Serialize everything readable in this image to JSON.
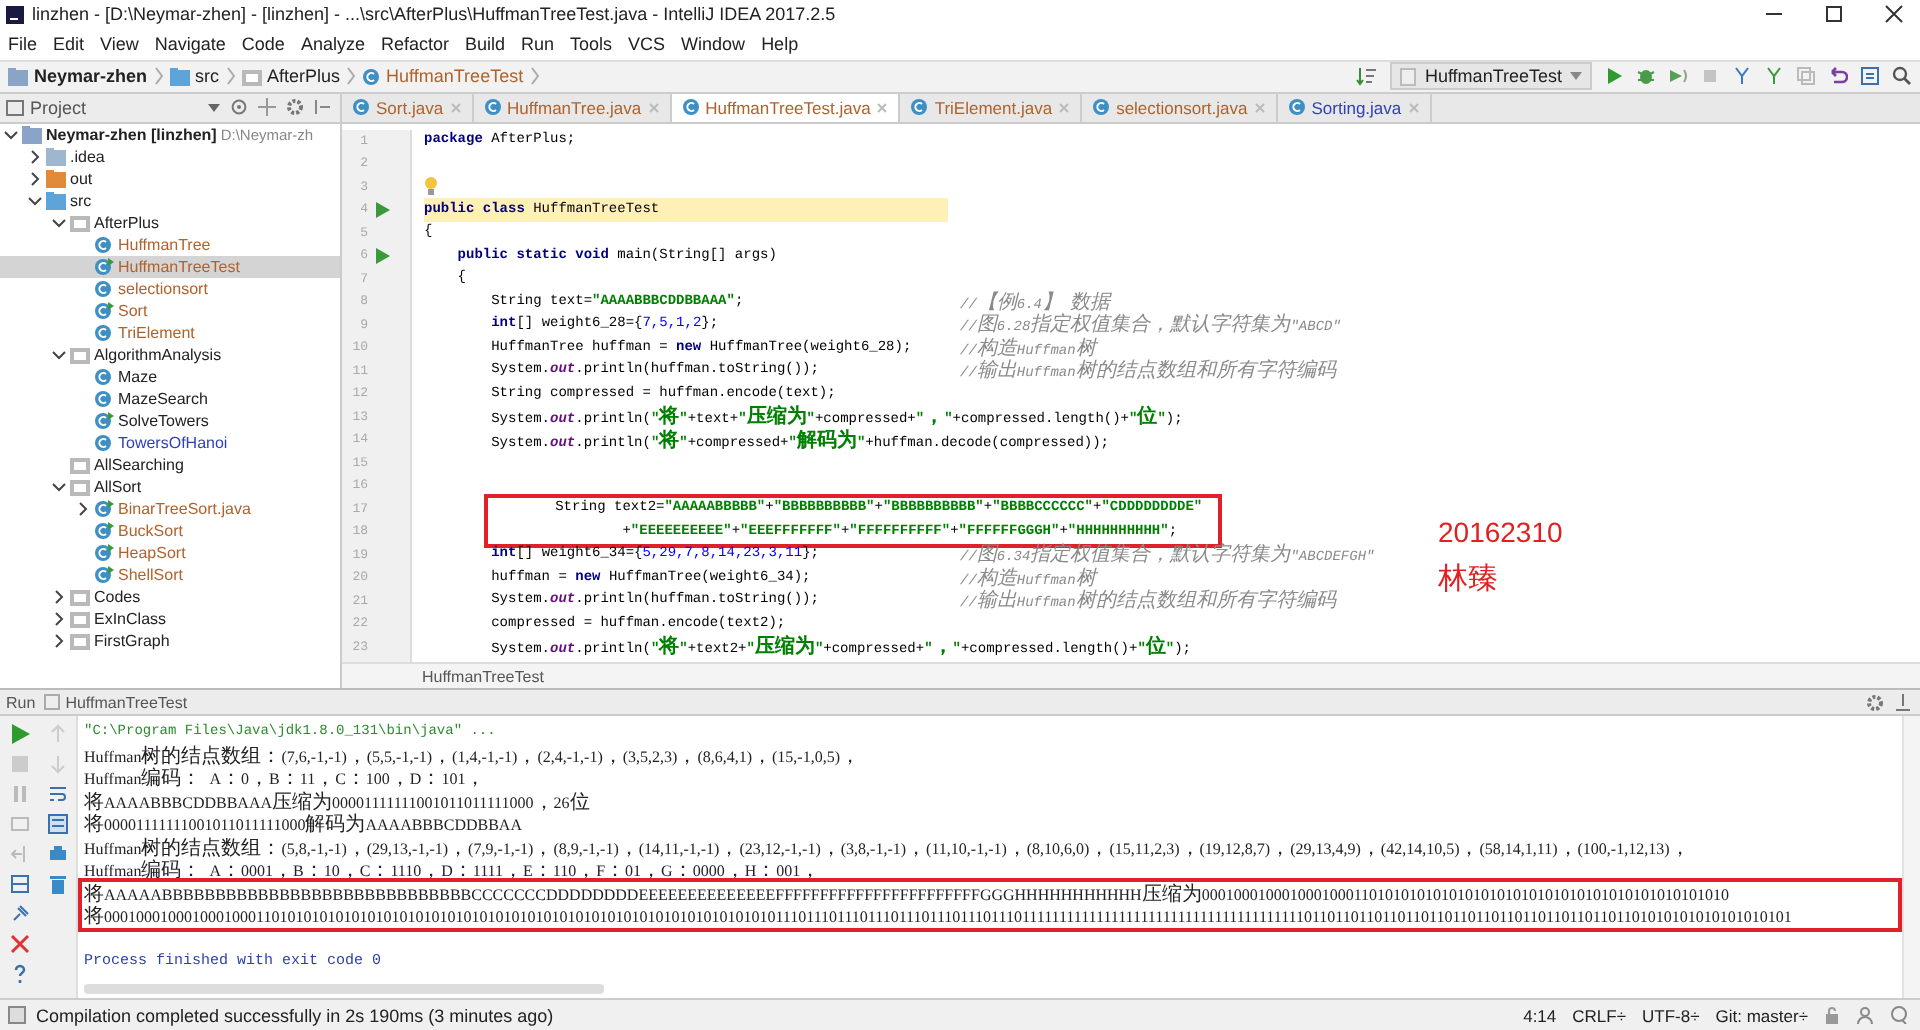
{
  "window": {
    "title": "linzhen - [D:\\Neymar-zhen] - [linzhen] - ...\\src\\AfterPlus\\HuffmanTreeTest.java - IntelliJ IDEA 2017.2.5"
  },
  "menu": [
    "File",
    "Edit",
    "View",
    "Navigate",
    "Code",
    "Analyze",
    "Refactor",
    "Build",
    "Run",
    "Tools",
    "VCS",
    "Window",
    "Help"
  ],
  "breadcrumb": [
    {
      "label": "Neymar-zhen",
      "kind": "module"
    },
    {
      "label": "src",
      "kind": "source"
    },
    {
      "label": "AfterPlus",
      "kind": "package"
    },
    {
      "label": "HuffmanTreeTest",
      "kind": "main"
    }
  ],
  "run_config": "HuffmanTreeTest",
  "project": {
    "title": "Project",
    "tree": [
      {
        "label": "Neymar-zhen [linzhen]",
        "path": "D:\\Neymar-zh",
        "kind": "module",
        "expanded": true,
        "selected": false,
        "children": [
          {
            "label": ".idea",
            "kind": "folder",
            "expanded": false,
            "selected": false
          },
          {
            "label": "out",
            "kind": "excluded",
            "expanded": false,
            "selected": false
          },
          {
            "label": "src",
            "kind": "source",
            "expanded": true,
            "selected": false,
            "children": [
              {
                "label": "AfterPlus",
                "kind": "package",
                "expanded": true,
                "selected": false,
                "children": [
                  {
                    "label": "HuffmanTree",
                    "kind": "class",
                    "color": "#b0622c",
                    "selected": false
                  },
                  {
                    "label": "HuffmanTreeTest",
                    "kind": "main",
                    "color": "#b0622c",
                    "selected": true
                  },
                  {
                    "label": "selectionsort",
                    "kind": "class",
                    "color": "#b0622c",
                    "selected": false
                  },
                  {
                    "label": "Sort",
                    "kind": "main",
                    "color": "#b0622c",
                    "selected": false
                  },
                  {
                    "label": "TriElement",
                    "kind": "class",
                    "color": "#b0622c",
                    "selected": false
                  }
                ]
              },
              {
                "label": "AlgorithmAnalysis",
                "kind": "package",
                "expanded": true,
                "selected": false,
                "children": [
                  {
                    "label": "Maze",
                    "kind": "class",
                    "color": "#222222",
                    "selected": false
                  },
                  {
                    "label": "MazeSearch",
                    "kind": "class",
                    "color": "#222222",
                    "selected": false
                  },
                  {
                    "label": "SolveTowers",
                    "kind": "main",
                    "color": "#222222",
                    "selected": false
                  },
                  {
                    "label": "TowersOfHanoi",
                    "kind": "class",
                    "color": "#3040b8",
                    "selected": false
                  }
                ]
              },
              {
                "label": "AllSearching",
                "kind": "package",
                "selected": false
              },
              {
                "label": "AllSort",
                "kind": "package",
                "expanded": true,
                "selected": false,
                "children": [
                  {
                    "label": "BinarTreeSort.java",
                    "kind": "main",
                    "color": "#b0622c",
                    "expanded": false,
                    "selected": false
                  },
                  {
                    "label": "BuckSort",
                    "kind": "main",
                    "color": "#b0622c",
                    "selected": false
                  },
                  {
                    "label": "HeapSort",
                    "kind": "main",
                    "color": "#b0622c",
                    "selected": false
                  },
                  {
                    "label": "ShellSort",
                    "kind": "main",
                    "color": "#b0622c",
                    "selected": false
                  }
                ]
              },
              {
                "label": "Codes",
                "kind": "package",
                "expanded": false,
                "selected": false
              },
              {
                "label": "ExInClass",
                "kind": "package",
                "expanded": false,
                "selected": false
              },
              {
                "label": "FirstGraph",
                "kind": "package",
                "expanded": false,
                "selected": false
              }
            ]
          }
        ]
      }
    ]
  },
  "tabs": [
    {
      "label": "Sort.java",
      "color": "#b0622c",
      "selected": false
    },
    {
      "label": "HuffmanTree.java",
      "color": "#b0622c",
      "selected": false
    },
    {
      "label": "HuffmanTreeTest.java",
      "color": "#b0622c",
      "selected": true
    },
    {
      "label": "TriElement.java",
      "color": "#b0622c",
      "selected": false
    },
    {
      "label": "selectionsort.java",
      "color": "#b0622c",
      "selected": false
    },
    {
      "label": "Sorting.java",
      "color": "#3040b8",
      "selected": false
    }
  ],
  "editor": {
    "lines": [
      {
        "number": "1",
        "kind": "code",
        "current": false,
        "boxed": false,
        "code": [
          {
            "kind": "kw",
            "text": "package"
          },
          {
            "kind": "pl",
            "text": " AfterPlus;"
          }
        ]
      },
      {
        "number": "2",
        "kind": "code"
      },
      {
        "number": "3",
        "kind": "bulb"
      },
      {
        "number": "4",
        "kind": "run",
        "current": true,
        "boxed": false,
        "code": [
          {
            "kind": "kw",
            "text": "public class "
          },
          {
            "kind": "pl",
            "text": "HuffmanTreeTest"
          }
        ]
      },
      {
        "number": "5",
        "kind": "code",
        "current": false,
        "boxed": false,
        "code": [
          {
            "kind": "pl",
            "text": "{"
          }
        ]
      },
      {
        "number": "6",
        "kind": "run",
        "current": false,
        "boxed": false,
        "code": [
          {
            "kind": "kw",
            "text": "    public static void "
          },
          {
            "kind": "pl",
            "text": "main(String[] args)"
          }
        ]
      },
      {
        "number": "7",
        "kind": "code",
        "current": false,
        "boxed": false,
        "code": [
          {
            "kind": "pl",
            "text": "    {"
          }
        ]
      },
      {
        "number": "8",
        "kind": "code",
        "current": false,
        "boxed": false,
        "code": [
          {
            "kind": "pl",
            "text": "        String text="
          },
          {
            "kind": "str",
            "text": "\"AAAABBBCDDBBAAA\""
          },
          {
            "kind": "pl",
            "text": ";"
          }
        ],
        "comment": "//【例6.4】 数据"
      },
      {
        "number": "9",
        "kind": "code",
        "current": false,
        "boxed": false,
        "code": [
          {
            "kind": "kw",
            "text": "        int"
          },
          {
            "kind": "pl",
            "text": "[] weight6_28={"
          },
          {
            "kind": "num",
            "text": "7,5,1,2"
          },
          {
            "kind": "pl",
            "text": "};"
          }
        ],
        "comment": "//图6.28指定权值集合，默认字符集为\"ABCD\""
      },
      {
        "number": "10",
        "kind": "code",
        "current": false,
        "boxed": false,
        "code": [
          {
            "kind": "pl",
            "text": "        HuffmanTree huffman = "
          },
          {
            "kind": "kw",
            "text": "new "
          },
          {
            "kind": "pl",
            "text": "HuffmanTree(weight6_28);"
          }
        ],
        "comment": "//构造Huffman树"
      },
      {
        "number": "11",
        "kind": "code",
        "current": false,
        "boxed": false,
        "code": [
          {
            "kind": "pl",
            "text": "        System."
          },
          {
            "kind": "fld",
            "text": "out"
          },
          {
            "kind": "pl",
            "text": ".println(huffman.toString());"
          }
        ],
        "comment": "//输出Huffman树的结点数组和所有字符编码"
      },
      {
        "number": "12",
        "kind": "code",
        "current": false,
        "boxed": false,
        "code": [
          {
            "kind": "pl",
            "text": "        String compressed = huffman.encode(text);"
          }
        ]
      },
      {
        "number": "13",
        "kind": "code",
        "current": false,
        "boxed": false,
        "code": [
          {
            "kind": "pl",
            "text": "        System."
          },
          {
            "kind": "fld",
            "text": "out"
          },
          {
            "kind": "pl",
            "text": ".println("
          },
          {
            "kind": "str",
            "text": "\"将\""
          },
          {
            "kind": "pl",
            "text": "+text+"
          },
          {
            "kind": "str",
            "text": "\"压缩为\""
          },
          {
            "kind": "pl",
            "text": "+compressed+"
          },
          {
            "kind": "str",
            "text": "\"，\""
          },
          {
            "kind": "pl",
            "text": "+compressed.length()+"
          },
          {
            "kind": "str",
            "text": "\"位\""
          },
          {
            "kind": "pl",
            "text": ");"
          }
        ]
      },
      {
        "number": "14",
        "kind": "code",
        "current": false,
        "boxed": false,
        "code": [
          {
            "kind": "pl",
            "text": "        System."
          },
          {
            "kind": "fld",
            "text": "out"
          },
          {
            "kind": "pl",
            "text": ".println("
          },
          {
            "kind": "str",
            "text": "\"将\""
          },
          {
            "kind": "pl",
            "text": "+compressed+"
          },
          {
            "kind": "str",
            "text": "\"解码为\""
          },
          {
            "kind": "pl",
            "text": "+huffman.decode(compressed));"
          }
        ]
      },
      {
        "number": "15",
        "kind": "code"
      },
      {
        "number": "16",
        "kind": "code"
      },
      {
        "number": "17",
        "kind": "code",
        "current": false,
        "boxed": true,
        "code": [
          {
            "kind": "pl",
            "text": "        String text2="
          },
          {
            "kind": "str",
            "text": "\"AAAAABBBBB\""
          },
          {
            "kind": "pl",
            "text": "+"
          },
          {
            "kind": "str",
            "text": "\"BBBBBBBBBB\""
          },
          {
            "kind": "pl",
            "text": "+"
          },
          {
            "kind": "str",
            "text": "\"BBBBBBBBBB\""
          },
          {
            "kind": "pl",
            "text": "+"
          },
          {
            "kind": "str",
            "text": "\"BBBBCCCCCC\""
          },
          {
            "kind": "pl",
            "text": "+"
          },
          {
            "kind": "str",
            "text": "\"CDDDDDDDDE\""
          }
        ]
      },
      {
        "number": "18",
        "kind": "code",
        "current": false,
        "boxed": true,
        "code": [
          {
            "kind": "pl",
            "text": "                +"
          },
          {
            "kind": "str",
            "text": "\"EEEEEEEEEE\""
          },
          {
            "kind": "pl",
            "text": "+"
          },
          {
            "kind": "str",
            "text": "\"EEEFFFFFFF\""
          },
          {
            "kind": "pl",
            "text": "+"
          },
          {
            "kind": "str",
            "text": "\"FFFFFFFFFF\""
          },
          {
            "kind": "pl",
            "text": "+"
          },
          {
            "kind": "str",
            "text": "\"FFFFFFGGGH\""
          },
          {
            "kind": "pl",
            "text": "+"
          },
          {
            "kind": "str",
            "text": "\"HHHHHHHHHH\""
          },
          {
            "kind": "pl",
            "text": ";"
          }
        ]
      },
      {
        "number": "19",
        "kind": "code",
        "current": false,
        "boxed": false,
        "code": [
          {
            "kind": "kw",
            "text": "        int"
          },
          {
            "kind": "pl",
            "text": "[] weight6_34={"
          },
          {
            "kind": "num",
            "text": "5,29,7,8,14,23,3,11"
          },
          {
            "kind": "pl",
            "text": "};"
          }
        ],
        "comment": "//图6.34指定权值集合，默认字符集为\"ABCDEFGH\""
      },
      {
        "number": "20",
        "kind": "code",
        "current": false,
        "boxed": false,
        "code": [
          {
            "kind": "pl",
            "text": "        huffman = "
          },
          {
            "kind": "kw",
            "text": "new "
          },
          {
            "kind": "pl",
            "text": "HuffmanTree(weight6_34);"
          }
        ],
        "comment": "//构造Huffman树"
      },
      {
        "number": "21",
        "kind": "code",
        "current": false,
        "boxed": false,
        "code": [
          {
            "kind": "pl",
            "text": "        System."
          },
          {
            "kind": "fld",
            "text": "out"
          },
          {
            "kind": "pl",
            "text": ".println(huffman.toString());"
          }
        ],
        "comment": "//输出Huffman树的结点数组和所有字符编码"
      },
      {
        "number": "22",
        "kind": "code",
        "current": false,
        "boxed": false,
        "code": [
          {
            "kind": "pl",
            "text": "        compressed = huffman.encode(text2);"
          }
        ]
      },
      {
        "number": "23",
        "kind": "code",
        "current": false,
        "boxed": false,
        "code": [
          {
            "kind": "pl",
            "text": "        System."
          },
          {
            "kind": "fld",
            "text": "out"
          },
          {
            "kind": "pl",
            "text": ".println("
          },
          {
            "kind": "str",
            "text": "\"将\""
          },
          {
            "kind": "pl",
            "text": "+text2+"
          },
          {
            "kind": "str",
            "text": "\"压缩为\""
          },
          {
            "kind": "pl",
            "text": "+compressed+"
          },
          {
            "kind": "str",
            "text": "\"，\""
          },
          {
            "kind": "pl",
            "text": "+compressed.length()+"
          },
          {
            "kind": "str",
            "text": "\"位\""
          },
          {
            "kind": "pl",
            "text": ");"
          }
        ]
      }
    ],
    "annotation": [
      "20162310",
      "林臻"
    ],
    "footer": "HuffmanTreeTest"
  },
  "run": {
    "label": "Run",
    "tab": "HuffmanTreeTest",
    "lines": [
      {
        "kind": "command",
        "boxed": false,
        "text": "\"C:\\Program Files\\Java\\jdk1.8.0_131\\bin\\java\" ..."
      },
      {
        "kind": "output",
        "boxed": false,
        "text": "Huffman树的结点数组：(7,6,-1,-1)，(5,5,-1,-1)，(1,4,-1,-1)，(2,4,-1,-1)，(3,5,2,3)，(8,6,4,1)，(15,-1,0,5)，"
      },
      {
        "kind": "output",
        "boxed": false,
        "text": "Huffman编码：  A：0，B：11，C：100，D：101，"
      },
      {
        "kind": "output",
        "boxed": false,
        "text": "将AAAABBBCDDBBAAA压缩为00001111111001011011111000，26位"
      },
      {
        "kind": "output",
        "boxed": false,
        "text": "将00001111111001011011111000解码为AAAABBBCDDBBAA"
      },
      {
        "kind": "output",
        "boxed": false,
        "text": "Huffman树的结点数组：(5,8,-1,-1)，(29,13,-1,-1)，(7,9,-1,-1)，(8,9,-1,-1)，(14,11,-1,-1)，(23,12,-1,-1)，(3,8,-1,-1)，(11,10,-1,-1)，(8,10,6,0)，(15,11,2,3)，(19,12,8,7)，(29,13,4,9)，(42,14,10,5)，(58,14,1,11)，(100,-1,12,13)，"
      },
      {
        "kind": "output",
        "boxed": false,
        "text": "Huffman编码：  A：0001，B：10，C：1110，D：1111，E：110，F：01，G：0000，H：001，"
      },
      {
        "kind": "output",
        "boxed": true,
        "text": "将AAAAABBBBBBBBBBBBBBBBBBBBBBBBBBBBBCCCCCCCDDDDDDDDEEEEEEEEEEEEEEFFFFFFFFFFFFFFFFFFFFFFFGGGHHHHHHHHHHH压缩为000100010001000100011010101010101010101010101010101010101010101010"
      },
      {
        "kind": "output",
        "boxed": true,
        "text": "将000100010001000100011010101010101010101010101010101010101010101010101010101010101010111011101110111011101110111011101111111111111111111111111111111111111101101101101101101101101101101101101101101101010101010101010101"
      },
      {
        "kind": "exit",
        "boxed": false,
        "text": "Process finished with exit code 0"
      }
    ]
  },
  "status_bar": {
    "message": "Compilation completed successfully in 2s 190ms (3 minutes ago)",
    "items": [
      "4:14",
      "CRLF÷",
      "UTF-8÷",
      "Git: master÷"
    ]
  }
}
